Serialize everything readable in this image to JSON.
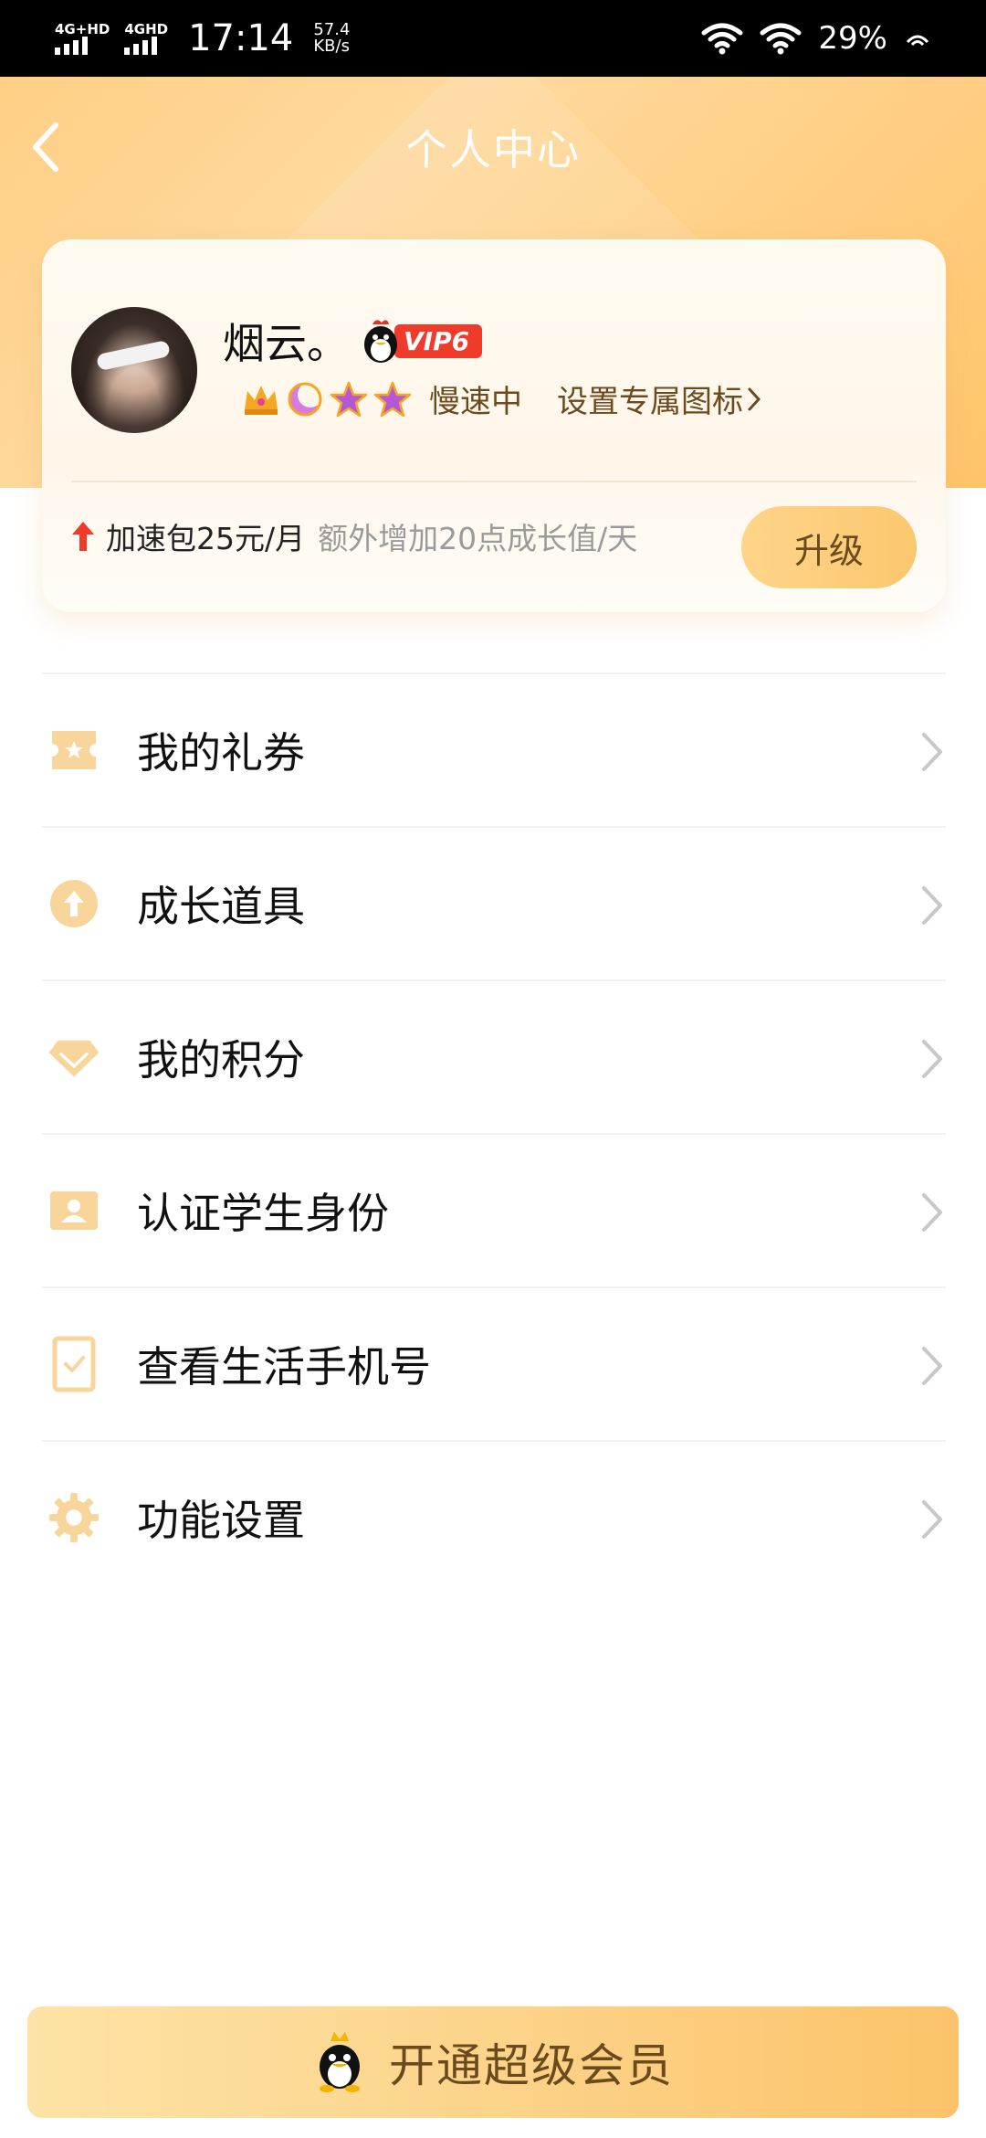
{
  "status_bar": {
    "sim1": "4G+HD",
    "sim2": "4GHD",
    "time": "17:14",
    "speed_value": "57.4",
    "speed_unit": "KB/s",
    "battery": "29%"
  },
  "header": {
    "title": "个人中心"
  },
  "profile": {
    "username": "烟云。",
    "vip_level": "VIP6",
    "speed_status": "慢速中",
    "custom_icon_link": "设置专属图标",
    "boost_main": "加速包25元/月",
    "boost_sub": "额外增加20点成长值/天",
    "upgrade_label": "升级",
    "level_icons": [
      "crown-icon",
      "moon-icon",
      "star-icon",
      "star-icon"
    ]
  },
  "menu": {
    "items": [
      {
        "label": "我的礼券",
        "icon": "coupon-icon"
      },
      {
        "label": "成长道具",
        "icon": "growth-arrow-icon"
      },
      {
        "label": "我的积分",
        "icon": "diamond-icon"
      },
      {
        "label": "认证学生身份",
        "icon": "id-card-icon"
      },
      {
        "label": "查看生活手机号",
        "icon": "phone-check-icon"
      },
      {
        "label": "功能设置",
        "icon": "gear-icon"
      }
    ]
  },
  "cta": {
    "label": "开通超级会员"
  },
  "colors": {
    "accent": "#fcc36a",
    "accent_text": "#6b4a1e",
    "vip_red": "#f03a2a"
  }
}
